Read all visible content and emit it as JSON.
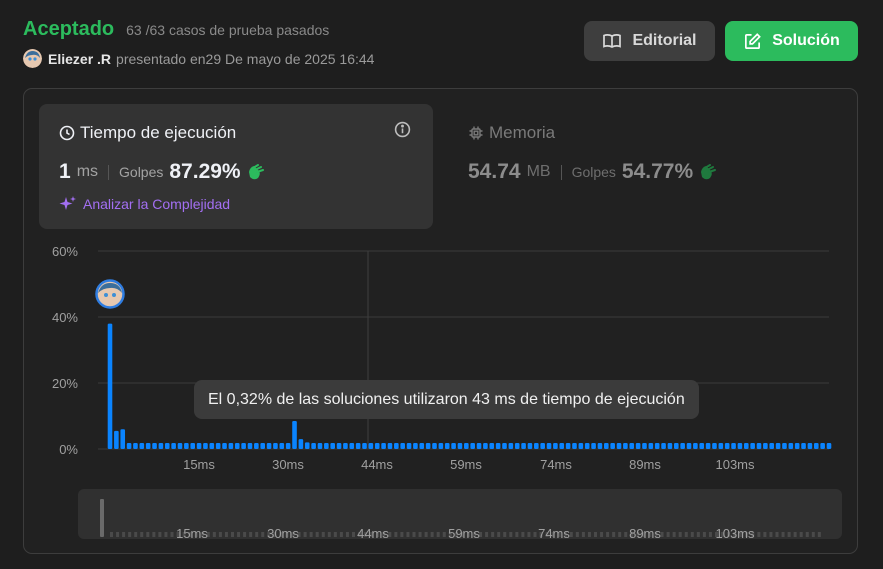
{
  "header": {
    "status": "Aceptado",
    "tests": "63 /63 casos de prueba pasados",
    "author": "Eliezer .R",
    "submitted": "presentado en29 De mayo de 2025 16:44"
  },
  "buttons": {
    "editorial": "Editorial",
    "solution": "Solución"
  },
  "runtime": {
    "title": "Tiempo de ejecución",
    "value": "1",
    "unit": "ms",
    "beats_label": "Golpes",
    "beats_value": "87.29%",
    "analyze": "Analizar la Complejidad"
  },
  "memory": {
    "title": "Memoria",
    "value": "54.74",
    "unit": "MB",
    "beats_label": "Golpes",
    "beats_value": "54.77%"
  },
  "tooltip": "El 0,32% de las soluciones utilizaron 43 ms de tiempo de ejecución",
  "colors": {
    "accent": "#2cbb5d",
    "bar": "#0a84ff",
    "purple": "#a36ff2"
  },
  "chart_data": {
    "type": "bar",
    "y_ticks": [
      "60%",
      "40%",
      "20%",
      "0%"
    ],
    "ylim": [
      0,
      60
    ],
    "x_tick_labels": [
      "15ms",
      "30ms",
      "44ms",
      "59ms",
      "74ms",
      "89ms",
      "103ms"
    ],
    "values": [
      38,
      5.5,
      6,
      1.8,
      1.8,
      1.8,
      1.8,
      1.8,
      1.8,
      1.8,
      1.8,
      1.8,
      1.8,
      1.8,
      1.8,
      1.8,
      1.8,
      1.8,
      1.8,
      1.8,
      1.8,
      1.8,
      1.8,
      1.8,
      1.8,
      1.8,
      1.8,
      1.8,
      1.8,
      8.5,
      3,
      2,
      1.8,
      1.8,
      1.8,
      1.8,
      1.8,
      1.8,
      1.8,
      1.8,
      1.8,
      1.8,
      1.8,
      1.8,
      1.8,
      1.8,
      1.8,
      1.8,
      1.8,
      1.8,
      1.8,
      1.8,
      1.8,
      1.8,
      1.8,
      1.8,
      1.8,
      1.8,
      1.8,
      1.8,
      1.8,
      1.8,
      1.8,
      1.8,
      1.8,
      1.8,
      1.8,
      1.8,
      1.8,
      1.8,
      1.8,
      1.8,
      1.8,
      1.8,
      1.8,
      1.8,
      1.8,
      1.8,
      1.8,
      1.8,
      1.8,
      1.8,
      1.8,
      1.8,
      1.8,
      1.8,
      1.8,
      1.8,
      1.8,
      1.8,
      1.8,
      1.8,
      1.8,
      1.8,
      1.8,
      1.8,
      1.8,
      1.8,
      1.8,
      1.8,
      1.8,
      1.8,
      1.8,
      1.8,
      1.8,
      1.8,
      1.8,
      1.8,
      1.8,
      1.8,
      1.8,
      1.8,
      1.8,
      1.8
    ],
    "grid": true
  }
}
